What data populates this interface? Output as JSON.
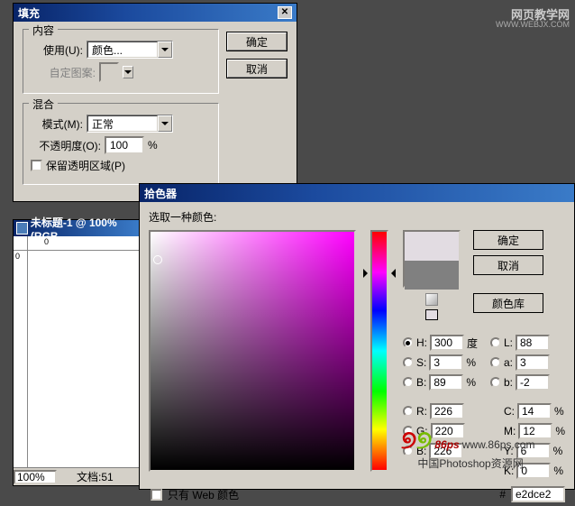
{
  "watermark": {
    "text": "网页教学网",
    "url": "WWW.WEBJX.COM"
  },
  "fill": {
    "title": "填充",
    "content_group": "内容",
    "use_label": "使用(U):",
    "use_value": "颜色...",
    "custom_pattern": "自定图案:",
    "blend_group": "混合",
    "mode_label": "模式(M):",
    "mode_value": "正常",
    "opacity_label": "不透明度(O):",
    "opacity_value": "100",
    "opacity_unit": "%",
    "preserve_trans": "保留透明区域(P)",
    "ok": "确定",
    "cancel": "取消"
  },
  "doc": {
    "title": "未标题-1 @ 100% (RGB",
    "zoom": "100%",
    "status_label": "文档:",
    "status_value": "51",
    "ruler_top_0": "0",
    "ruler_left_0": "0"
  },
  "cp": {
    "title": "拾色器",
    "instruction": "选取一种颜色:",
    "ok": "确定",
    "cancel": "取消",
    "library": "颜色库",
    "web_only": "只有 Web 颜色",
    "labels": {
      "H": "H:",
      "S": "S:",
      "B": "B:",
      "R": "R:",
      "G": "G:",
      "Bb": "B:",
      "L": "L:",
      "a": "a:",
      "b": "b:",
      "C": "C:",
      "M": "M:",
      "Y": "Y:",
      "K": "K:"
    },
    "units": {
      "deg": "度",
      "pct": "%"
    },
    "values": {
      "H": "300",
      "S": "3",
      "B": "89",
      "R": "226",
      "G": "220",
      "Bb": "226",
      "L": "88",
      "a": "3",
      "b": "-2",
      "C": "14",
      "M": "12",
      "Y": "6",
      "K": "0"
    },
    "hex_label": "#",
    "hex": "e2dce2",
    "logo_url": "www.86ps.com",
    "logo_text": "中国Photoshop资源网",
    "logo_brand": "86ps"
  }
}
